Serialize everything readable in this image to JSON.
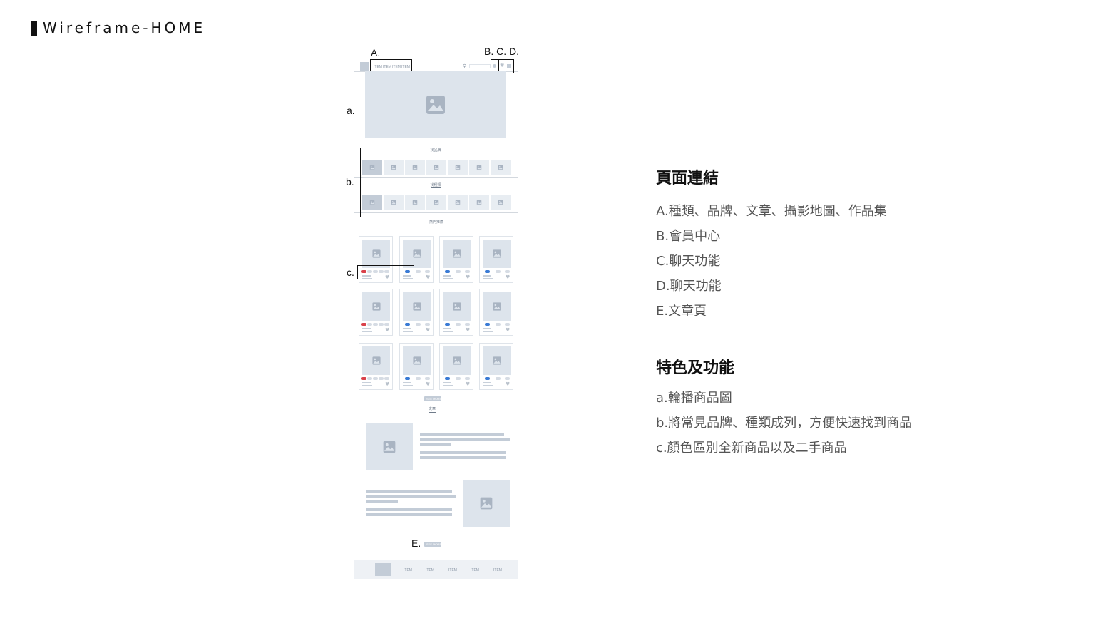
{
  "title": "Wireframe-HOME",
  "markers": {
    "A": "A.",
    "BCD": "B. C. D.",
    "a": "a.",
    "b": "b.",
    "c": "c.",
    "E": "E."
  },
  "nav_items": [
    "ITEM",
    "ITEM",
    "ITEM",
    "ITEM"
  ],
  "sections": {
    "brands": "找品牌",
    "categories": "找種類",
    "latest": "熱門推薦",
    "articles": "文章"
  },
  "card_text": {
    "tag": "Tag",
    "name": "Lorem NEW",
    "price": "NT$ 999"
  },
  "buttons": {
    "see_more_products": "SEE MORE",
    "see_more_articles": "SEE MORE"
  },
  "footer_items": [
    "ITEM",
    "ITEM",
    "ITEM",
    "ITEM",
    "ITEM"
  ],
  "links": {
    "heading": "頁面連結",
    "items": [
      "A.種類、品牌、文章、攝影地圖、作品集",
      "B.會員中心",
      "C.聊天功能",
      "D.聊天功能",
      "E.文章頁"
    ]
  },
  "features": {
    "heading": "特色及功能",
    "items": [
      "a.輪播商品圖",
      "b.將常見品牌、種類成列，方便快速找到商品",
      "c.顏色區別全新商品以及二手商品"
    ]
  },
  "colors": {
    "placeholder": "#dde4ec",
    "new_tag": "#d9414a",
    "used_tag": "#3a7bd5"
  }
}
